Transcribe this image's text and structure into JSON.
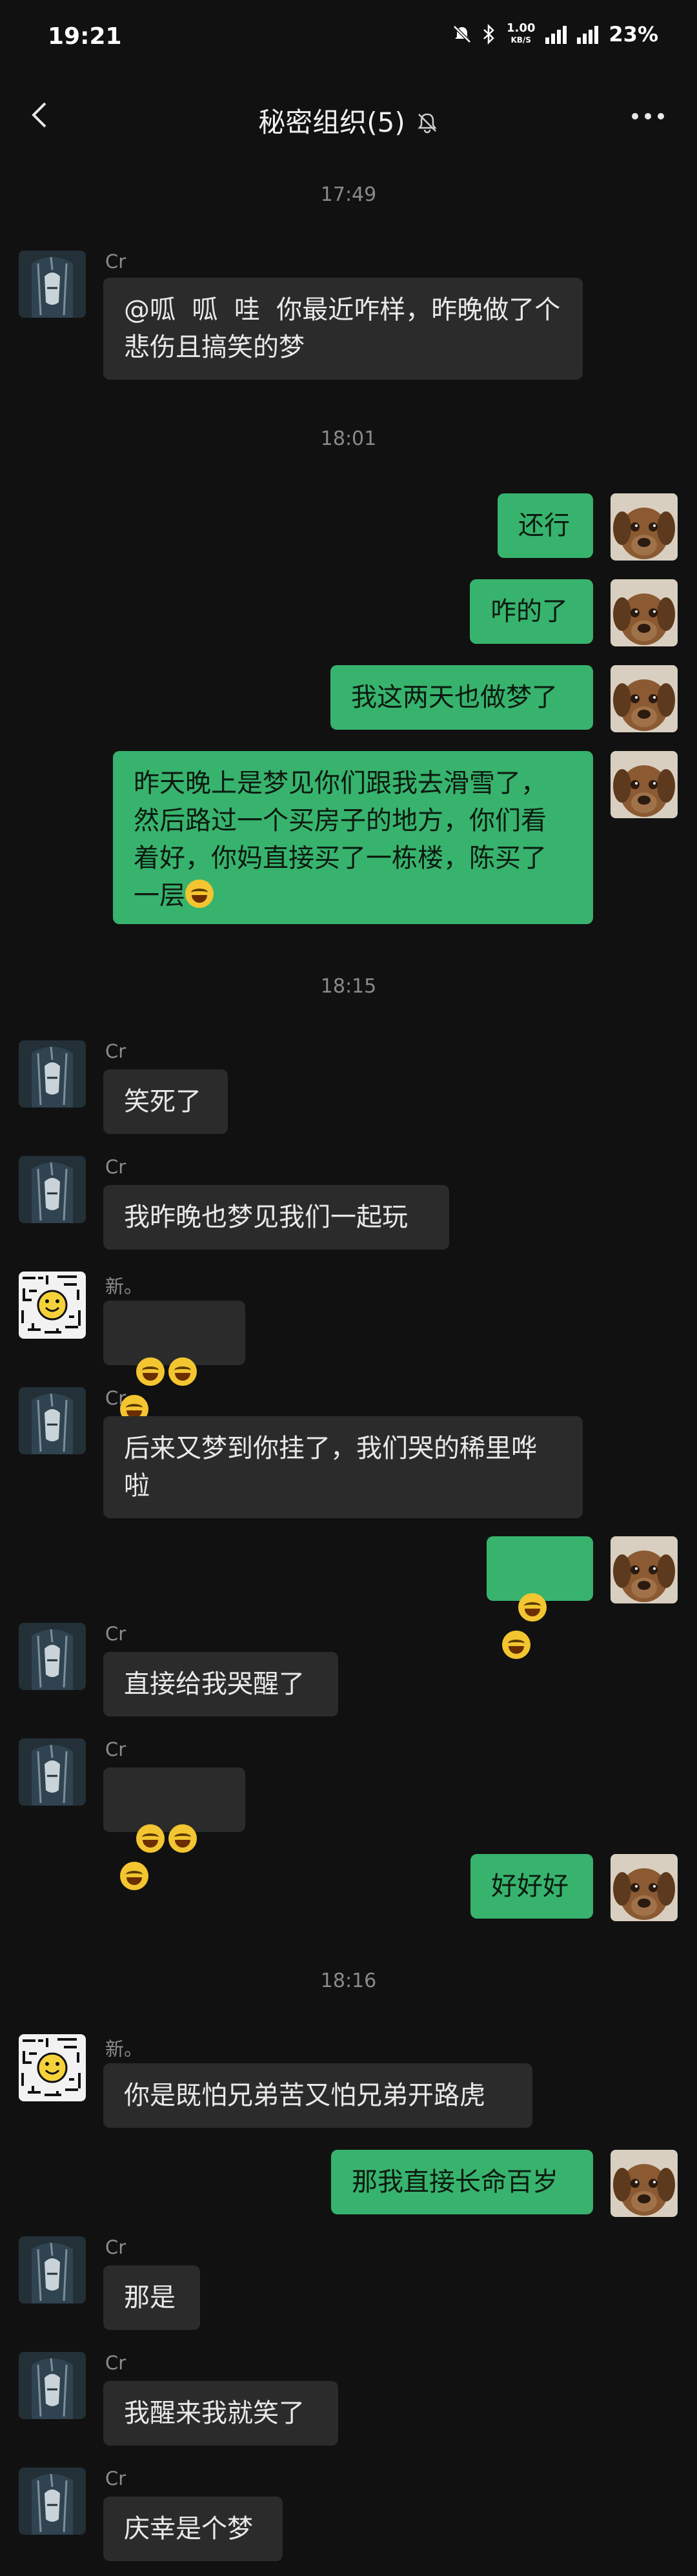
{
  "status": {
    "time": "19:21",
    "net_speed_value": "1.00",
    "net_speed_unit": "KB/S",
    "battery": "23%"
  },
  "header": {
    "title": "秘密组织(5)"
  },
  "timestamps": [
    "17:49",
    "18:01",
    "18:15",
    "18:16"
  ],
  "names": {
    "cr": "Cr",
    "xin": "新。"
  },
  "messages": [
    "@呱  呱  哇  你最近咋样，昨晚做了个\n悲伤且搞笑的梦",
    "还行",
    "咋的了",
    "我这两天也做梦了",
    "昨天晚上是梦见你们跟我去滑雪了，\n然后路过一个买房子的地方，你们看\n着好，你妈直接买了一栋楼，陈买了\n一层",
    "笑死了",
    "我昨晚也梦见我们一起玩",
    "后来又梦到你挂了，我们哭的稀里哗\n啦",
    "直接给我哭醒了",
    "好好好",
    "你是既怕兄弟苦又怕兄弟开路虎",
    "那我直接长命百岁",
    "那是",
    "我醒来我就笑了",
    "庆幸是个梦"
  ],
  "colors": {
    "outgoing_bubble": "#37b36d",
    "incoming_bubble": "#2b2b2b",
    "background": "#111111"
  }
}
